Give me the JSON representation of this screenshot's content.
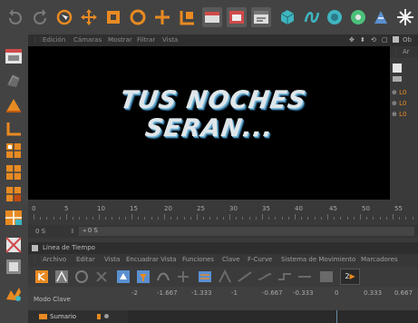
{
  "viewport": {
    "menu": [
      "Edición",
      "Cámaras",
      "Mostrar",
      "Filtrar",
      "Vista"
    ],
    "title_text": "TUS NOCHES SERAN..."
  },
  "right_panel": {
    "header": "Ob",
    "sub": "Ar",
    "items": [
      "L0",
      "L0",
      "L0"
    ]
  },
  "ruler": {
    "ticks": [
      "0",
      "5",
      "10",
      "15",
      "20",
      "25",
      "30",
      "35",
      "40",
      "45",
      "50",
      "55"
    ]
  },
  "frame_bar": {
    "current": "0 S",
    "field": "0 S"
  },
  "timeline": {
    "title": "Línea de Tiempo",
    "menu": [
      "Archivo",
      "Editar",
      "Vista",
      "Encuadrar Vista",
      "Funciones",
      "Clave",
      "F-Curve",
      "Sistema de Movimiento",
      "Marcadores"
    ],
    "mode": "Modo Clave",
    "values": [
      "-2",
      "-1.667",
      "-1.333",
      "-1",
      "-0.667",
      "-0.333",
      "0",
      "0.333",
      "0.667"
    ],
    "row_label": "Sumario",
    "key_label": "2"
  },
  "icons": {
    "top": [
      "undo-icon",
      "redo-icon",
      "live-select-icon",
      "move-icon",
      "scale-icon",
      "rotate-icon",
      "add-icon",
      "coordinate-system-icon",
      "render-view-icon",
      "render-picture-viewer-icon",
      "render-settings-icon",
      "cube-icon",
      "spline-icon",
      "nurbs-icon",
      "array-icon",
      "deformer-icon",
      "scene-light-icon"
    ],
    "left": [
      "viewport-icon",
      "texture-icon",
      "model-mode-icon",
      "axis-icon",
      "points-icon",
      "edges-icon",
      "polygons-icon",
      "soft-icon",
      "snap-icon",
      "grid-icon",
      "paint-icon"
    ]
  },
  "colors": {
    "accent_orange": "#e88a22",
    "accent_red": "#d04a4a",
    "accent_teal": "#3fb6c0",
    "title_blue": "#5aa3cf"
  }
}
